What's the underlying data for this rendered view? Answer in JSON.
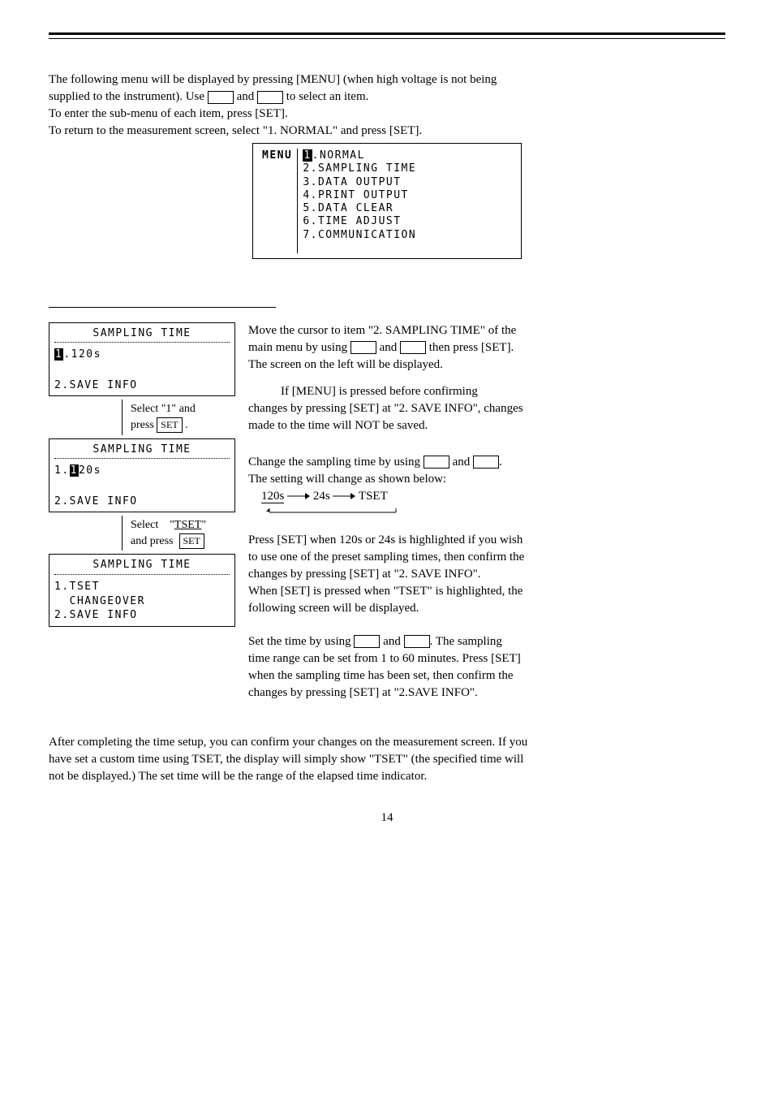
{
  "intro": {
    "line1a": "The following menu will be displayed by pressing [MENU] (when high voltage is not being",
    "line2a": "supplied to the instrument). Use ",
    "line2b": " and ",
    "line2c": " to select an item.",
    "line3": "To enter the sub-menu of each item, press [SET].",
    "line4": "To return to the measurement screen, select \"1. NORMAL\" and press [SET]."
  },
  "lcd_menu": {
    "menu_label": "MENU",
    "hl": "1",
    "item1_rest": ".NORMAL",
    "item2": "2.SAMPLING TIME",
    "item3": "3.DATA OUTPUT",
    "item4": "4.PRINT OUTPUT",
    "item5": "5.DATA CLEAR",
    "item6": "6.TIME ADJUST",
    "item7": "7.COMMUNICATION"
  },
  "sampling": {
    "lcd1_title": "SAMPLING TIME",
    "lcd1_row1_hl": "1",
    "lcd1_row1_rest": ".120s",
    "lcd1_row2": "2.SAVE INFO",
    "flow1a": "Select \"1\" and",
    "flow1b": "press ",
    "set": "SET",
    "flow1c": " .",
    "lcd2_title": "SAMPLING TIME",
    "lcd2_row1a": "1.",
    "lcd2_row1_hl": "1",
    "lcd2_row1b": "20s",
    "lcd2_row2": "2.SAVE INFO",
    "flow2a": "Select \"TSET\"",
    "flow2b": "and press",
    "lcd3_title": "SAMPLING TIME",
    "lcd3_row1": "1.TSET",
    "lcd3_row2": "  CHANGEOVER",
    "lcd3_row3": "2.SAVE INFO"
  },
  "right": {
    "p1a": "Move the cursor to item \"2. SAMPLING TIME\" of the",
    "p1b": "main menu by using ",
    "p1c": " and ",
    "p1d": " then press [SET].",
    "p1e": "The screen on the left will be displayed.",
    "p2a": "If [MENU] is pressed before confirming",
    "p2b": "changes by pressing [SET] at \"2. SAVE INFO\", changes",
    "p2c": "made to the time will NOT be saved.",
    "p3a": "Change the sampling time by using ",
    "p3b": " and ",
    "p3c": ".",
    "p3d": "The setting will change as shown below:",
    "p3e": "120s",
    "p3f": "24s",
    "p3g": "TSET",
    "p4a": "Press [SET] when 120s or 24s is highlighted if you wish",
    "p4b": "to use one of the preset sampling times, then confirm the",
    "p4c": "changes by pressing [SET] at \"2. SAVE INFO\".",
    "p4d": "When [SET] is pressed when \"TSET\" is highlighted, the",
    "p4e": "following screen will be displayed.",
    "p5a": "Set the time by using ",
    "p5b": " and ",
    "p5c": ". The sampling",
    "p5d": "time range can be set from 1 to 60 minutes. Press [SET]",
    "p5e": "when the sampling time has been set, then confirm the",
    "p5f": "changes by pressing [SET] at \"2.SAVE INFO\"."
  },
  "footer": {
    "p1": "After completing the time setup, you can confirm your changes on the measurement screen. If you",
    "p2": "have set a custom time using TSET, the display will simply show \"TSET\" (the specified time will",
    "p3": "not be displayed.) The set time will be the range of the elapsed time indicator.",
    "page": "14"
  }
}
